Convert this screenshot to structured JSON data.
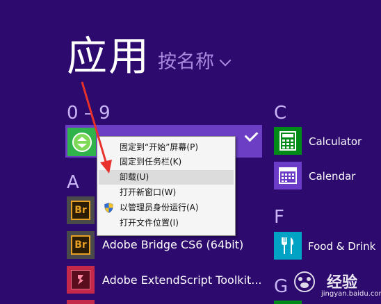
{
  "header": {
    "title": "应用",
    "sort_label": "按名称"
  },
  "groups": {
    "digits": "0 – 9",
    "a": "A",
    "c": "C",
    "f": "F",
    "g": "G"
  },
  "apps_left": [
    {
      "label": "Adobe Bridge CS6 (64bit)",
      "icon": "bridge-icon",
      "tile_text": "Br"
    },
    {
      "label": "Adobe ExtendScript Toolkit...",
      "icon": "extendscript-icon"
    }
  ],
  "partial_br_tile_text": "Br",
  "apps_right": [
    {
      "label": "Calculator",
      "icon": "calculator-icon"
    },
    {
      "label": "Calendar",
      "icon": "calendar-icon"
    },
    {
      "label": "Food & Drink",
      "icon": "food-drink-icon"
    }
  ],
  "context_menu": {
    "items": [
      {
        "label": "固定到“开始”屏幕(P)"
      },
      {
        "label": "固定到任务栏(K)"
      },
      {
        "label": "卸载(U)"
      },
      {
        "label": "打开新窗口(W)"
      },
      {
        "label": "以管理员身份运行(A)"
      },
      {
        "label": "打开文件位置(I)"
      }
    ]
  },
  "watermark": {
    "text": "经验",
    "sub": "jingyan.baidu.com"
  },
  "colors": {
    "background": "#2d0a6e",
    "selected": "#6b3ec4",
    "adobe_tile": "#4a4a4a",
    "calc_tile": "#008a17",
    "calendar_tile": "#6a3cc7",
    "food_tile": "#00a3c4",
    "arrow": "#e8312a"
  }
}
